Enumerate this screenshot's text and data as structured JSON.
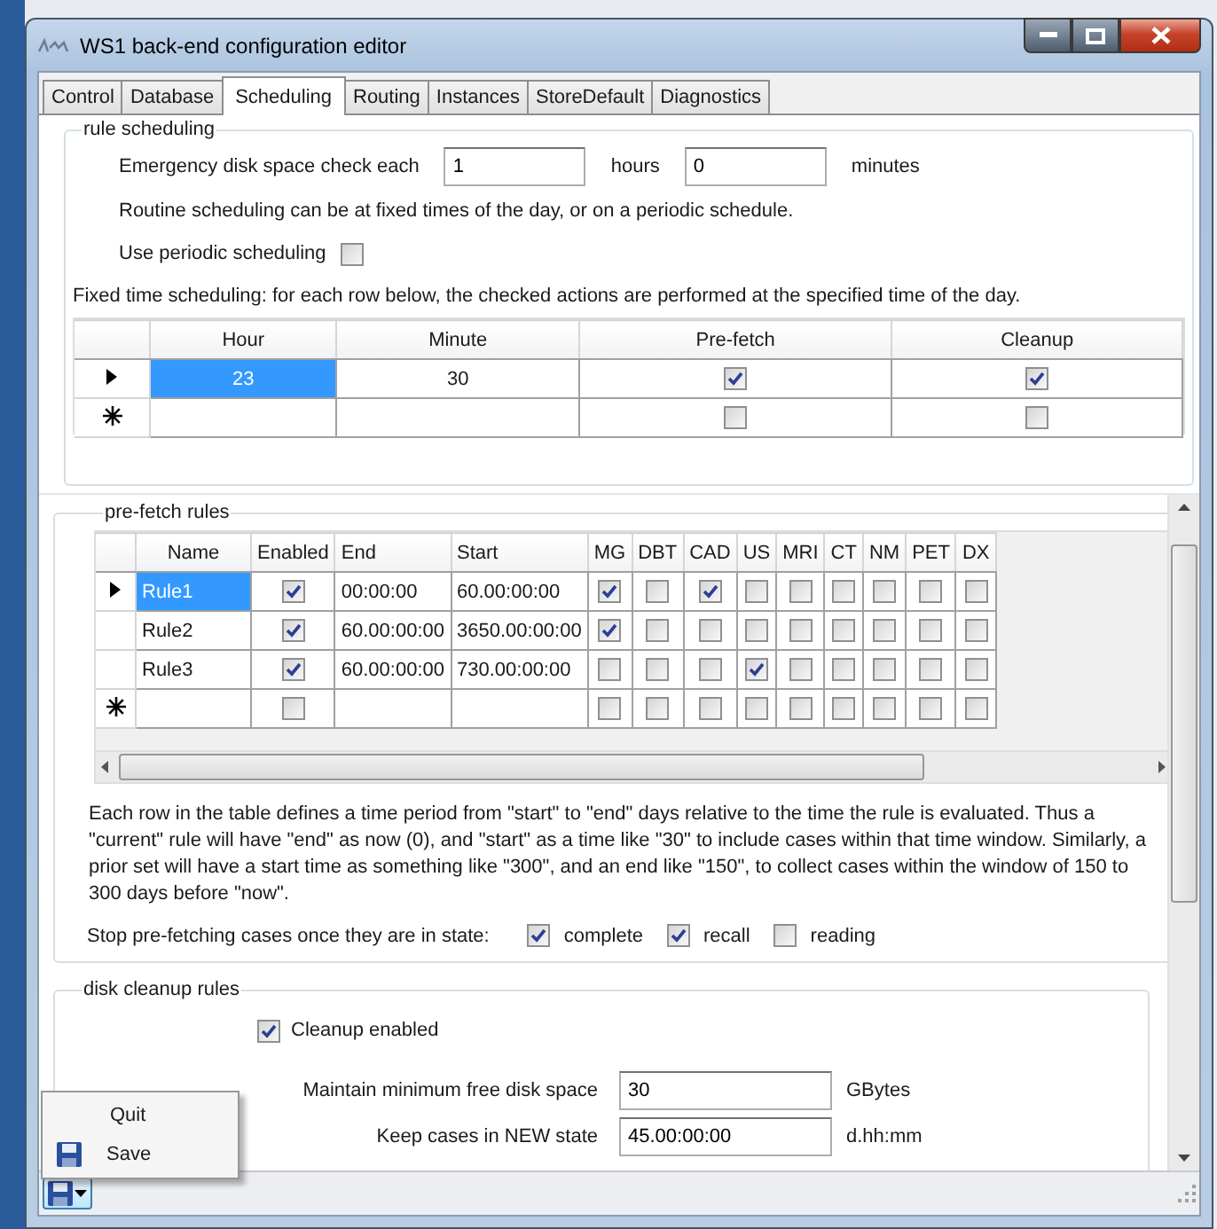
{
  "window": {
    "title": "WS1 back-end configuration editor"
  },
  "tabs": [
    {
      "label": "Control",
      "selected": false
    },
    {
      "label": "Database",
      "selected": false
    },
    {
      "label": "Scheduling",
      "selected": true
    },
    {
      "label": "Routing",
      "selected": false
    },
    {
      "label": "Instances",
      "selected": false
    },
    {
      "label": "StoreDefault",
      "selected": false
    },
    {
      "label": "Diagnostics",
      "selected": false
    }
  ],
  "rule_scheduling": {
    "title": "rule scheduling",
    "emergency_label": "Emergency disk space check each",
    "hours_value": "1",
    "hours_label": "hours",
    "minutes_value": "0",
    "minutes_label": "minutes",
    "routine_text": "Routine scheduling can be at fixed times of the day, or on a periodic schedule.",
    "periodic": {
      "label": "Use periodic scheduling",
      "checked": false
    },
    "fixed_text": "Fixed time scheduling: for each row below, the checked actions are performed at the specified time of the day.",
    "grid": {
      "columns": [
        "Hour",
        "Minute",
        "Pre-fetch",
        "Cleanup"
      ],
      "rows": [
        {
          "kind": "current",
          "selected": true,
          "hour": "23",
          "minute": "30",
          "prefetch": true,
          "cleanup": true
        },
        {
          "kind": "new",
          "selected": false,
          "prefetch": false,
          "cleanup": false
        }
      ]
    }
  },
  "prefetch_rules": {
    "title": "pre-fetch rules",
    "columns": [
      "Name",
      "Enabled",
      "End",
      "Start",
      "MG",
      "DBT",
      "CAD",
      "US",
      "MRI",
      "CT",
      "NM",
      "PET",
      "DX"
    ],
    "rows": [
      {
        "kind": "current",
        "selected": true,
        "name": "Rule1",
        "enabled": true,
        "end": "00:00:00",
        "start": "60.00:00:00",
        "modalities": [
          true,
          false,
          true,
          false,
          false,
          false,
          false,
          false,
          false
        ]
      },
      {
        "kind": "normal",
        "selected": false,
        "name": "Rule2",
        "enabled": true,
        "end": "60.00:00:00",
        "start": "3650.00:00:00",
        "modalities": [
          true,
          false,
          false,
          false,
          false,
          false,
          false,
          false,
          false
        ]
      },
      {
        "kind": "normal",
        "selected": false,
        "name": "Rule3",
        "enabled": true,
        "end": "60.00:00:00",
        "start": "730.00:00:00",
        "modalities": [
          false,
          false,
          false,
          true,
          false,
          false,
          false,
          false,
          false
        ]
      },
      {
        "kind": "new",
        "selected": false,
        "enabled": false,
        "modalities": [
          false,
          false,
          false,
          false,
          false,
          false,
          false,
          false,
          false
        ]
      }
    ],
    "explanation": "Each row in the table defines a time period from \"start\" to \"end\" days relative to the time the rule is evaluated. Thus a \"current\" rule will have \"end\" as now (0), and \"start\" as a time like \"30\" to include cases within that time window. Similarly, a prior set will have a start time as something like \"300\", and an end like \"150\", to collect cases within the window of 150 to 300 days before \"now\".",
    "stop_label": "Stop pre-fetching cases once they are in state:",
    "states": [
      {
        "label": "complete",
        "checked": true
      },
      {
        "label": "recall",
        "checked": true
      },
      {
        "label": "reading",
        "checked": false
      }
    ]
  },
  "disk_cleanup": {
    "title": "disk cleanup rules",
    "cleanup_enabled": {
      "label": "Cleanup enabled",
      "checked": true
    },
    "fields": [
      {
        "label": "Maintain minimum free disk space",
        "value": "30",
        "unit": "GBytes"
      },
      {
        "label": "Keep cases in NEW state",
        "value": "45.00:00:00",
        "unit": "d.hh:mm"
      }
    ]
  },
  "menu": {
    "items": [
      {
        "kind": "plain",
        "label": "Quit"
      },
      {
        "kind": "save",
        "label": "Save"
      }
    ]
  }
}
